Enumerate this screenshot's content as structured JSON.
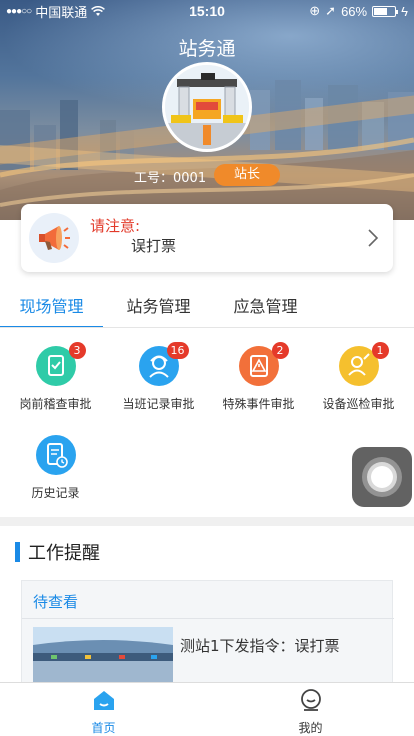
{
  "status_bar": {
    "carrier": "中国联通",
    "time": "15:10",
    "battery": "66%",
    "battery_level": 0.66
  },
  "app": {
    "title": "站务通"
  },
  "profile": {
    "job_label": "工号：0001",
    "role": "站长"
  },
  "notice": {
    "title": "请注意:",
    "message": "误打票"
  },
  "tabs": [
    {
      "label": "现场管理",
      "active": true
    },
    {
      "label": "站务管理",
      "active": false
    },
    {
      "label": "应急管理",
      "active": false
    }
  ],
  "grid": [
    {
      "label": "岗前稽查审批",
      "badge": "3",
      "icon": "clipboard-check-icon",
      "color": "#2fcba8"
    },
    {
      "label": "当班记录审批",
      "badge": "16",
      "icon": "worker-icon",
      "color": "#2aa3ef"
    },
    {
      "label": "特殊事件审批",
      "badge": "2",
      "icon": "alert-clipboard-icon",
      "color": "#f2703a"
    },
    {
      "label": "设备巡检审批",
      "badge": "1",
      "icon": "inspection-person-icon",
      "color": "#f5c02e"
    },
    {
      "label": "历史记录",
      "badge": "",
      "icon": "history-document-icon",
      "color": "#2aa3ef"
    }
  ],
  "reminders": {
    "section_title": "工作提醒",
    "pending_label": "待查看",
    "items": [
      {
        "text": "测站1下发指令：误打票"
      }
    ]
  },
  "bottom_nav": [
    {
      "label": "首页",
      "icon": "home-icon",
      "active": true
    },
    {
      "label": "我的",
      "icon": "profile-icon",
      "active": false
    }
  ],
  "colors": {
    "accent": "#1a8ae6",
    "badge": "#e53a2a",
    "role_badge": "#f08a2a",
    "notice_title": "#e23a2a"
  }
}
